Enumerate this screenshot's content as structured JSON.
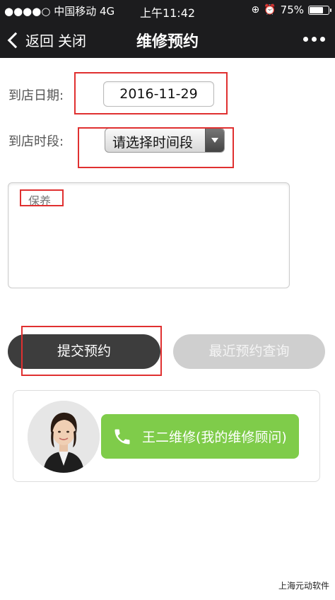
{
  "status_bar": {
    "carrier": "●●●●○ 中国移动  4G",
    "time": "上午11:42",
    "battery_text": "75%",
    "battery_level": 0.75
  },
  "nav": {
    "back_label": "返回",
    "close_label": "关闭",
    "title": "维修预约"
  },
  "form": {
    "date_label": "到店日期:",
    "date_value": "2016-11-29",
    "period_label": "到店时段:",
    "period_value": "请选择时间段",
    "notes_value": "保养"
  },
  "buttons": {
    "submit": "提交预约",
    "query": "最近预约查询"
  },
  "advisor": {
    "call_label": "王二维修(我的维修顾问)"
  },
  "footer": {
    "text": "上海元动软件"
  },
  "colors": {
    "bar_bg": "#1c1c1e",
    "submit_bg": "#3d3d3d",
    "query_bg": "#cfcfcf",
    "call_bg": "#7fcc4a",
    "highlight": "#e03030"
  }
}
